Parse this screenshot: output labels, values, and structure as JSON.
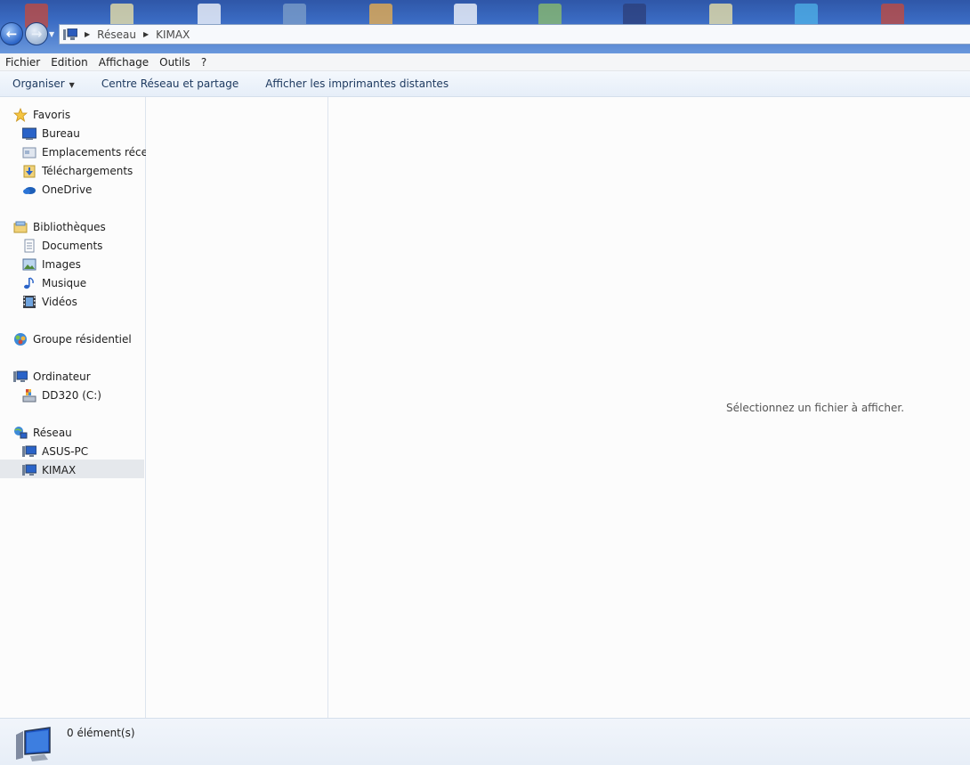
{
  "address_bar": {
    "crumbs": [
      "Réseau",
      "KIMAX"
    ]
  },
  "menu": [
    "Fichier",
    "Edition",
    "Affichage",
    "Outils",
    "?"
  ],
  "commands": {
    "organize": "Organiser",
    "network_center": "Centre Réseau et partage",
    "remote_printers": "Afficher les imprimantes distantes"
  },
  "nav": {
    "favorites": {
      "label": "Favoris",
      "items": [
        "Bureau",
        "Emplacements récent",
        "Téléchargements",
        "OneDrive"
      ]
    },
    "libraries": {
      "label": "Bibliothèques",
      "items": [
        "Documents",
        "Images",
        "Musique",
        "Vidéos"
      ]
    },
    "homegroup": {
      "label": "Groupe résidentiel"
    },
    "computer": {
      "label": "Ordinateur",
      "items": [
        "DD320 (C:)"
      ]
    },
    "network": {
      "label": "Réseau",
      "items": [
        "ASUS-PC",
        "KIMAX"
      ],
      "selected": "KIMAX"
    }
  },
  "preview": {
    "message": "Sélectionnez un fichier à afficher."
  },
  "status": {
    "count": "0 élément(s)"
  }
}
